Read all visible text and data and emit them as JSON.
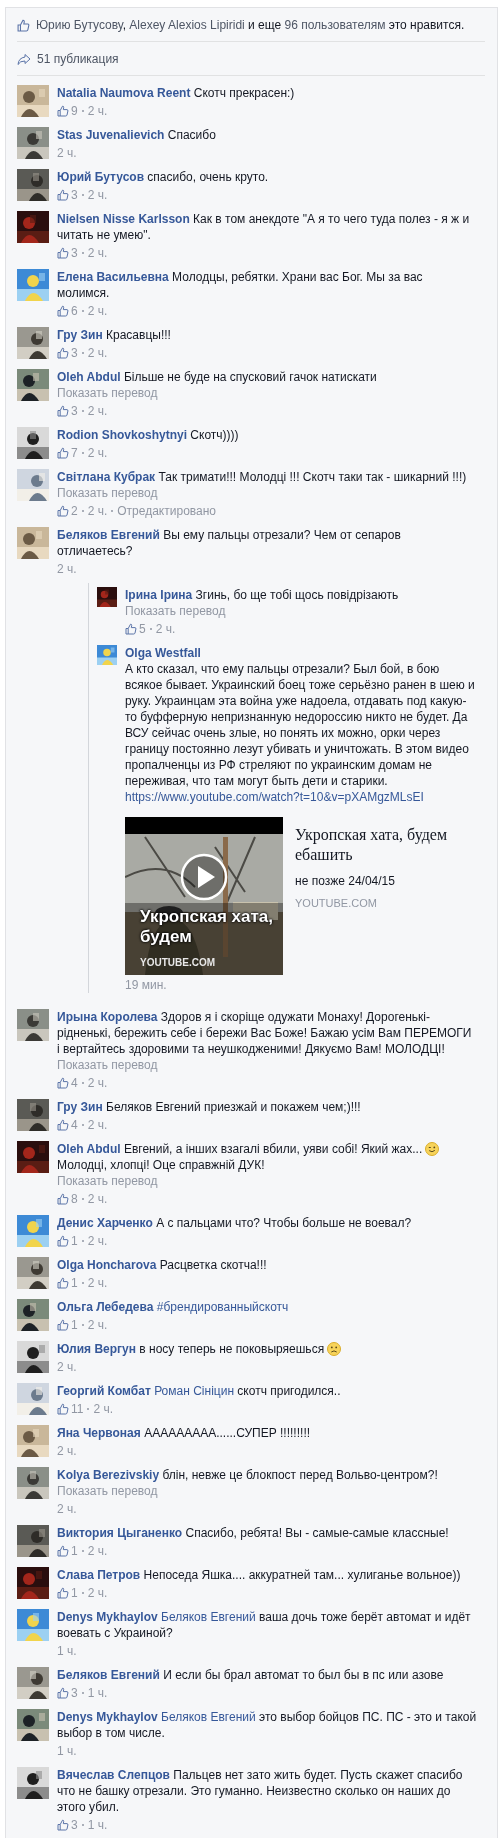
{
  "likes_summary": {
    "parts": [
      {
        "kind": "link",
        "text": "Юрию Бутусову"
      },
      {
        "kind": "text",
        "text": ", "
      },
      {
        "kind": "link",
        "text": "Alexey Alexios Lipiridi"
      },
      {
        "kind": "text",
        "text": " и еще "
      },
      {
        "kind": "link",
        "text": "96 пользователям"
      },
      {
        "kind": "text",
        "text": " это нравится."
      }
    ]
  },
  "shares": {
    "label": "51 публикация"
  },
  "comments": [
    {
      "author": "Natalia Naumova Reent",
      "text": "Скотч прекрасен:)",
      "likes": "9",
      "time": "2 ч."
    },
    {
      "author": "Stas Juvenalievich",
      "text": "Спасибо",
      "time": "2 ч."
    },
    {
      "author": "Юрий Бутусов",
      "text": "спасибо, очень круто.",
      "likes": "3",
      "time": "2 ч."
    },
    {
      "author": "Nielsen Nisse Karlsson",
      "text": "Как в том анекдоте \"А я то чего туда полез - я ж и читать не умею\".",
      "likes": "3",
      "time": "2 ч."
    },
    {
      "author": "Елена Васильевна",
      "text": "Молодцы, ребятки. Храни вас Бог. Мы за вас молимся.",
      "likes": "6",
      "time": "2 ч."
    },
    {
      "author": "Гру Зин",
      "text": "Красавцы!!!",
      "likes": "3",
      "time": "2 ч."
    },
    {
      "author": "Oleh Abdul",
      "text": "Більше не буде на спусковий гачок натискати",
      "translate": "Показать перевод",
      "likes": "3",
      "time": "2 ч."
    },
    {
      "author": "Rodion Shovkoshytnyi",
      "text": "Скотч))))",
      "likes": "7",
      "time": "2 ч."
    },
    {
      "author": "Світлана Кубрак",
      "text": "Так тримати!!! Молодці !!! Скотч таки так - шикарний !!!)",
      "translate": "Показать перевод",
      "likes": "2",
      "time": "2 ч.",
      "edited": "Отредактировано"
    },
    {
      "author": "Беляков Евгений",
      "text": "Вы ему пальцы отрезали? Чем от сепаров отличаетесь?",
      "time": "2 ч.",
      "replies": [
        {
          "kind": "inline",
          "author": "Ірина Ірина",
          "text": "Згинь, бо ще тобі щось повідрізають",
          "translate": "Показать перевод",
          "likes": "5",
          "time": "2 ч."
        },
        {
          "kind": "stacked",
          "author": "Olga Westfall",
          "text": "А кто сказал, что ему пальцы отрезали? Был бой, в бою всякое бывает. Украинский боец тоже серьёзно ранен в шею и руку. Украинцам эта война уже надоела, отдавать под какую-то буфферную непризнанную недороссию никто не будет. Да ВСУ сейчас очень злые, но понять их можно, орки через границу постоянно лезут убивать и уничтожать. В этом видео пропалченцы из РФ стреляют по украинским домам не переживая, что там могут быть дети и старики.",
          "link": "https://www.youtube.com/watch?t=10&v=pXAMgzMLsEI",
          "video": {
            "overlay_title": "Укропская хата, будем",
            "overlay_source": "YOUTUBE.COM",
            "title": "Укропская хата, будем ебашить",
            "description": "не позже 24/04/15",
            "source": "YOUTUBE.COM"
          },
          "time": "19 мин."
        }
      ]
    },
    {
      "author": "Ирына Королева",
      "text": "Здоров я і скоріще одужати Монаху! Дорогенькі-рідненькі, бережить себе і бережи Вас Боже! Бажаю усім Вам ПЕРЕМОГИ і вертайтесь здоровими та неушкодженими! Дякуємо Вам! МОЛОДЦІ!",
      "translate": "Показать перевод",
      "likes": "4",
      "time": "2 ч."
    },
    {
      "author": "Гру Зин",
      "text": "Беляков Евгений приезжай и покажем чем;)!!!",
      "likes": "4",
      "time": "2 ч."
    },
    {
      "author": "Oleh Abdul",
      "text": "Евгений, а інших взагалі вбили, уяви собі! Який жах...",
      "emoji": {
        "kind": "wink"
      },
      "text_after": "Молодці, хлопці! Оце справжній ДУК!",
      "translate": "Показать перевод",
      "likes": "8",
      "time": "2 ч."
    },
    {
      "author": "Денис Харченко",
      "text": "А с пальцами что? Чтобы больше не воевал?",
      "likes": "1",
      "time": "2 ч."
    },
    {
      "author": "Olga Honcharova",
      "text": "Расцветка скотча!!!",
      "likes": "1",
      "time": "2 ч."
    },
    {
      "author": "Ольга Лебедева",
      "hashtag": "#брендированныйскотч",
      "likes": "1",
      "time": "2 ч."
    },
    {
      "author": "Юлия Вергун",
      "text": "в носу теперь не поковыряешься",
      "emoji": {
        "kind": "sad"
      },
      "time": "2 ч."
    },
    {
      "author": "Георгий Комбат",
      "mention": "Роман Сініцин",
      "text": "скотч пригодился..",
      "likes": "11",
      "time": "2 ч."
    },
    {
      "author": "Яна Червоная",
      "text": "ААААААААА......СУПЕР !!!!!!!!!",
      "time": "2 ч."
    },
    {
      "author": "Kolya Berezivskiy",
      "text": "блін, невже це блокпост перед Вольво-центром?!",
      "translate": "Показать перевод",
      "time": "2 ч."
    },
    {
      "author": "Виктория Цыганенко",
      "text": "Спасибо, ребята! Вы - самые-самые классные!",
      "likes": "1",
      "time": "2 ч."
    },
    {
      "author": "Слава Петров",
      "text": "Непоседа Яшка.... аккуратней там... хулиганье вольное))",
      "likes": "1",
      "time": "2 ч."
    },
    {
      "author": "Denys Mykhaylov",
      "mention": "Беляков Евгений",
      "text": "ваша дочь тоже берёт автомат и идёт воевать с Украиной?",
      "time": "1 ч."
    },
    {
      "author": "Беляков Евгений",
      "text": "И если бы брал автомат то был бы в пс или азове",
      "likes": "3",
      "time": "1 ч."
    },
    {
      "author": "Denys Mykhaylov",
      "mention": "Беляков Евгений",
      "text": "это выбор бойцов ПС. ПС - это и такой выбор в том числе.",
      "time": "1 ч."
    },
    {
      "author": "Вячеслав Слепцов",
      "text": "Пальцев нет зато жить будет. Пусть скажет спасибо что не башку отрезали. Это гуманно. Неизвестно сколько он наших до этого убил.",
      "likes": "3",
      "time": "1 ч."
    }
  ]
}
